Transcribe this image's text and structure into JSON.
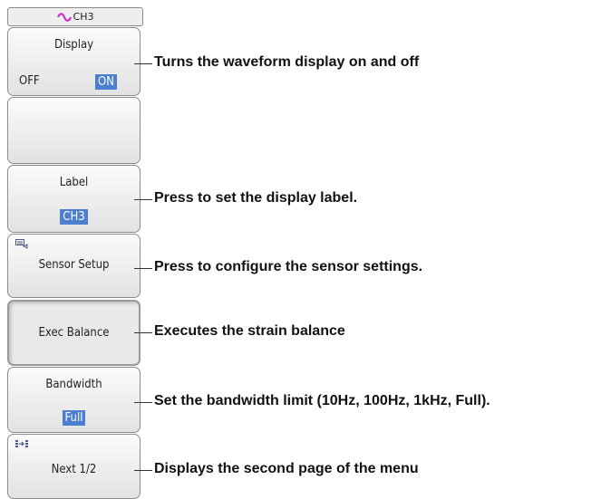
{
  "header": {
    "channel": "CH3",
    "wave_icon": "waveform-icon",
    "wave_color": "#d020d0"
  },
  "menu": {
    "display": {
      "title": "Display",
      "off": "OFF",
      "on": "ON",
      "selected": "ON"
    },
    "label": {
      "title": "Label",
      "value": "CH3"
    },
    "sensor_setup": {
      "title": "Sensor Setup",
      "icon": "keyboard-icon"
    },
    "exec_balance": {
      "title": "Exec Balance"
    },
    "bandwidth": {
      "title": "Bandwidth",
      "value": "Full"
    },
    "next": {
      "title": "Next 1/2",
      "icon": "page-arrow-icon"
    }
  },
  "callouts": {
    "display": "Turns the waveform display on and off",
    "label": "Press to set the display label.",
    "sensor_setup": "Press to configure the sensor settings.",
    "exec_balance": "Executes the strain balance",
    "bandwidth": "Set the bandwidth limit (10Hz, 100Hz, 1kHz, Full).",
    "next": "Displays the second page of the menu"
  },
  "colors": {
    "highlight": "#4c7fd0",
    "button_border": "#8c8c8c"
  }
}
